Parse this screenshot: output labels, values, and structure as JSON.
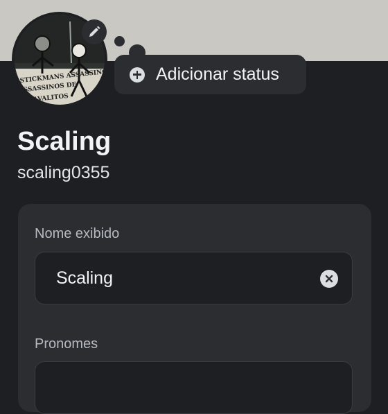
{
  "header": {
    "status_button_label": "Adicionar status"
  },
  "profile": {
    "display_name": "Scaling",
    "username": "scaling0355",
    "avatar_caption": "STICKMANS ASSASSINOS DE CAVALITOS"
  },
  "form": {
    "display_name_label": "Nome exibido",
    "display_name_value": "Scaling",
    "pronouns_label": "Pronomes",
    "pronouns_value": ""
  },
  "colors": {
    "background": "#1e1f23",
    "banner": "#c9c8c3",
    "surface": "#2b2d31",
    "text_primary": "#f2f3f5",
    "text_muted": "#b5bac1"
  },
  "icons": [
    "pencil-icon",
    "plus-circle-icon",
    "clear-x-icon"
  ]
}
